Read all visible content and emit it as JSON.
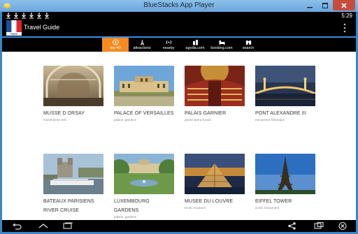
{
  "window": {
    "title": "BlueStacks App Player",
    "minimize_icon": "minimize-icon",
    "maximize_icon": "maximize-icon",
    "close_icon": "close-icon"
  },
  "statusbar": {
    "time": "5:29",
    "notification_count": 6
  },
  "appbar": {
    "title": "Travel Guide",
    "flag_label": "PARIS"
  },
  "tabs": [
    {
      "label": "top 40",
      "icon": "compass-icon",
      "active": true
    },
    {
      "label": "attractions",
      "icon": "tower-icon",
      "active": false
    },
    {
      "label": "nearby",
      "icon": "radar-icon",
      "active": false
    },
    {
      "label": "agoda.com",
      "icon": "hotel-icon",
      "active": false
    },
    {
      "label": "booking.com",
      "icon": "bed-icon",
      "active": false
    },
    {
      "label": "search",
      "icon": "binoculars-icon",
      "active": false
    }
  ],
  "places": [
    {
      "title": "MUSSE D ORSAY",
      "subtitle": "masterpiece arts"
    },
    {
      "title": "PALACE OF VERSAILLES",
      "subtitle": "palace, gardens"
    },
    {
      "title": "PALAIS GARNIER",
      "subtitle": "grand opera house"
    },
    {
      "title": "PONT ALEXANDRE III",
      "subtitle": "monument historique"
    },
    {
      "title": "BATEAUX PARISIENS",
      "title2": "RIVER CRUISE",
      "subtitle": ""
    },
    {
      "title": "LUXEMBOURG GARDENS",
      "subtitle": "palace, gardens"
    },
    {
      "title": "MUSEE DU LOUVRE",
      "subtitle": "iconic museum"
    },
    {
      "title": "EIFFEL TOWER",
      "subtitle": "iconic monument"
    }
  ],
  "colors": {
    "accent": "#f6891f",
    "divider": "#3b8de3",
    "window_frame": "#3a86c8"
  }
}
